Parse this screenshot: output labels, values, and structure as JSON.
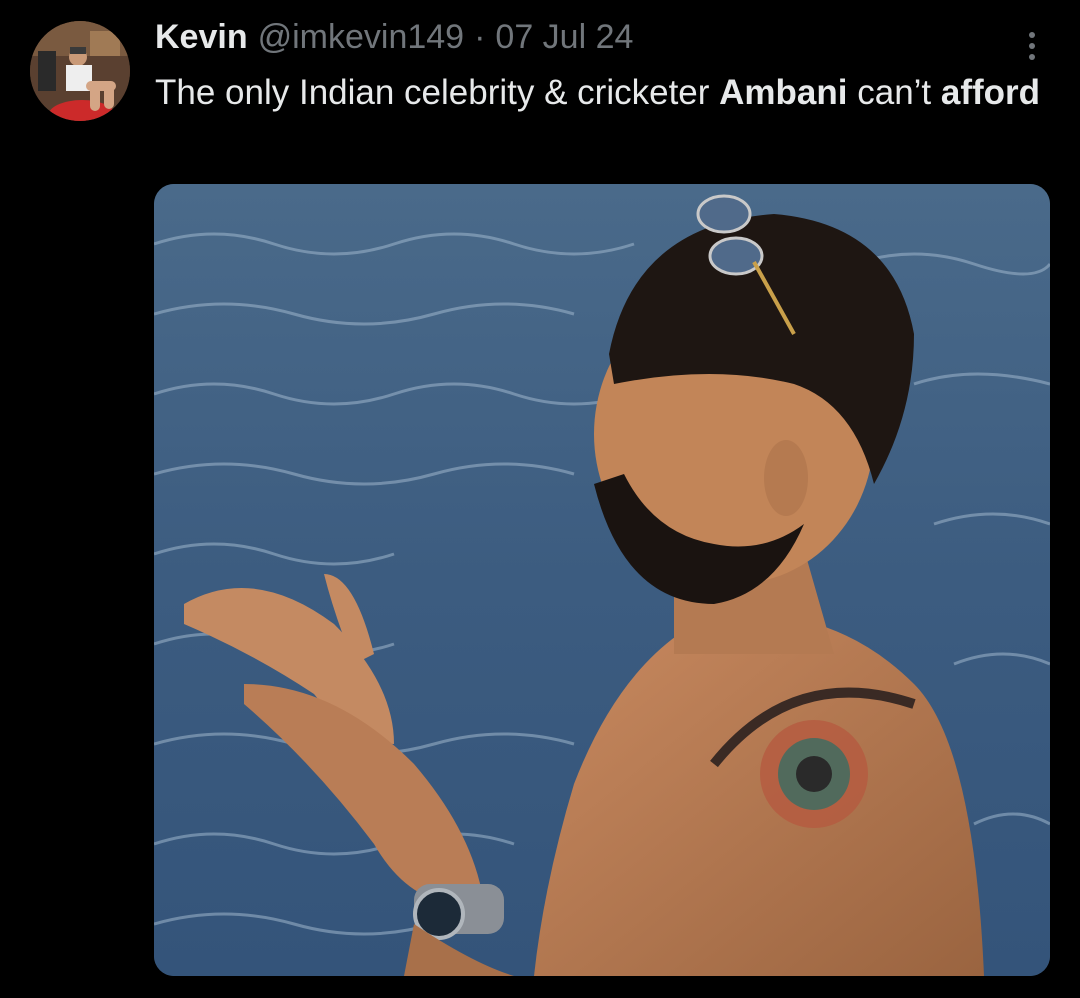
{
  "tweet": {
    "author": {
      "display_name": "Kevin",
      "handle": "@imkevin149",
      "avatar_icon": "avatar-photo"
    },
    "separator": "·",
    "date": "07 Jul 24",
    "more_icon": "more-vertical-icon",
    "text": {
      "part1": "The only Indian celebrity & cricketer ",
      "bold1": "Ambani",
      "part2": " can’t ",
      "bold2": "afford"
    },
    "media": {
      "alt": "Photo of a shirtless man with a beard and tattooed shoulder standing in a swimming pool, sunglasses on his head, hands raised together"
    }
  },
  "colors": {
    "background": "#000000",
    "primary_text": "#e7e9ea",
    "secondary_text": "#71767b"
  }
}
